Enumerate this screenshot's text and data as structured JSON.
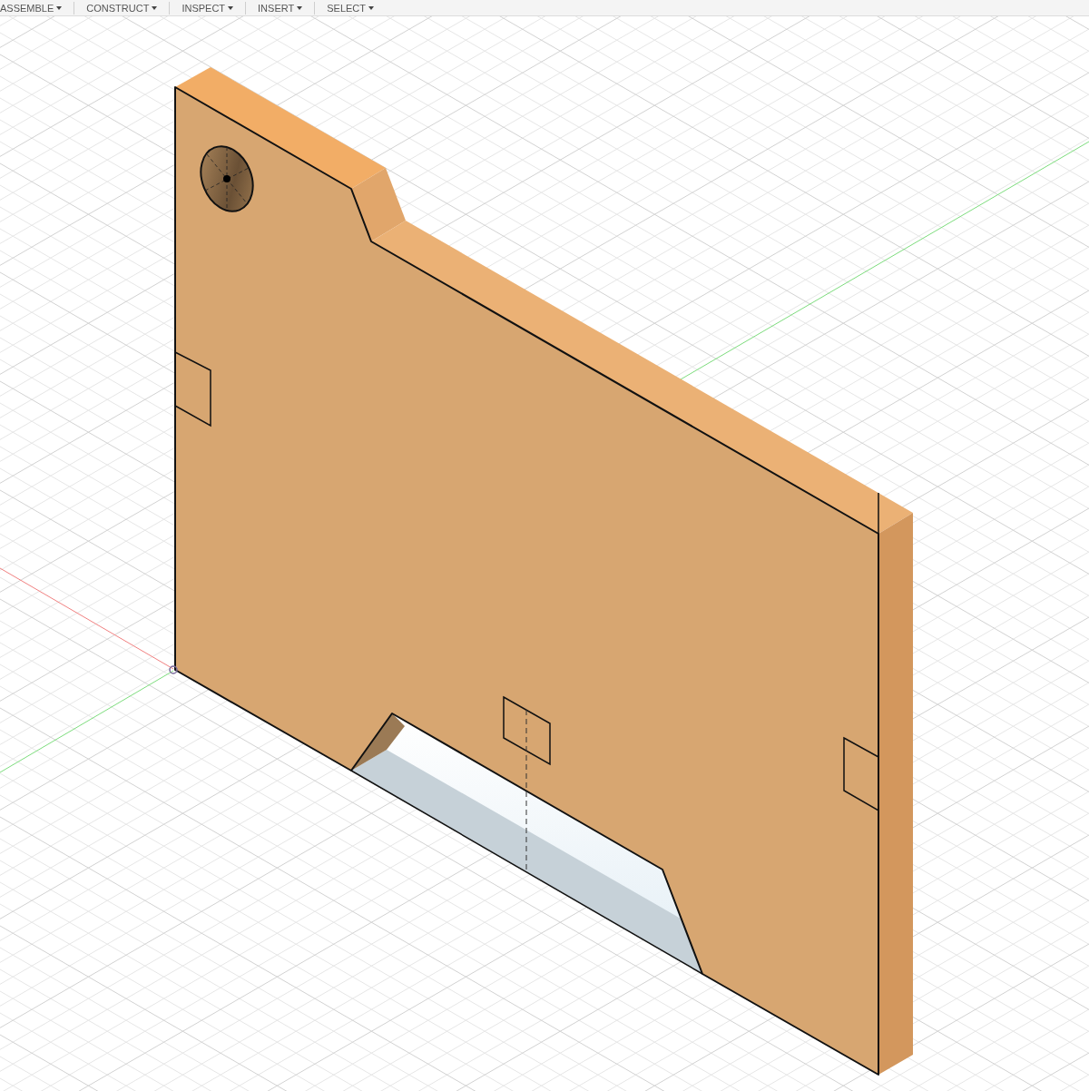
{
  "toolbar": {
    "menus": [
      {
        "label": "ASSEMBLE"
      },
      {
        "label": "CONSTRUCT"
      },
      {
        "label": "INSPECT"
      },
      {
        "label": "INSERT"
      },
      {
        "label": "SELECT"
      }
    ]
  }
}
